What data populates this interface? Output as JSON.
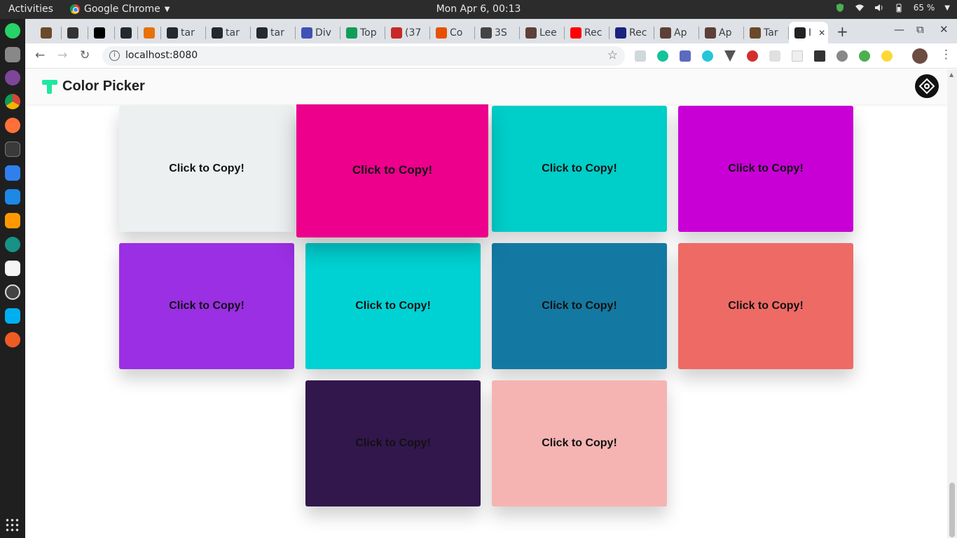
{
  "system": {
    "activities": "Activities",
    "app_name": "Google Chrome",
    "clock": "Mon Apr  6, 00:13",
    "battery": "65 %"
  },
  "browser": {
    "tabs": [
      {
        "label": "",
        "color": "#6b4a2b"
      },
      {
        "label": "",
        "color": "#333333"
      },
      {
        "label": "",
        "color": "#000000"
      },
      {
        "label": "",
        "color": "#24292e"
      },
      {
        "label": "",
        "color": "#e8710a"
      },
      {
        "label": "tar",
        "color": "#24292e"
      },
      {
        "label": "tar",
        "color": "#24292e"
      },
      {
        "label": "tar",
        "color": "#24292e"
      },
      {
        "label": "Div",
        "color": "#3f51b5"
      },
      {
        "label": "Top",
        "color": "#0f9d58"
      },
      {
        "label": "(37",
        "color": "#c62828"
      },
      {
        "label": "Co",
        "color": "#e65100"
      },
      {
        "label": "3S",
        "color": "#444444"
      },
      {
        "label": "Lee",
        "color": "#5d4037"
      },
      {
        "label": "Rec",
        "color": "#ff0000"
      },
      {
        "label": "Rec",
        "color": "#1a237e"
      },
      {
        "label": "Ap",
        "color": "#5d4037"
      },
      {
        "label": "Ap",
        "color": "#5d4037"
      },
      {
        "label": "Tar",
        "color": "#6b4a2b"
      },
      {
        "label": "I",
        "color": "#222222",
        "active": true
      }
    ],
    "url": "localhost:8080"
  },
  "app": {
    "title": "Color Picker",
    "cards": [
      {
        "label": "Click to Copy!",
        "color": "#ecf0f1"
      },
      {
        "label": "Click to Copy!",
        "color": "#ec008c"
      },
      {
        "label": "Click to Copy!",
        "color": "#00cec9"
      },
      {
        "label": "Click to Copy!",
        "color": "#c800d6"
      },
      {
        "label": "Click to Copy!",
        "color": "#9b2fe3"
      },
      {
        "label": "Click to Copy!",
        "color": "#00d2d3"
      },
      {
        "label": "Click to Copy!",
        "color": "#1479a2"
      },
      {
        "label": "Click to Copy!",
        "color": "#ee6a65"
      },
      {
        "label": "Click to Copy!",
        "color": "#32174d"
      },
      {
        "label": "Click to Copy!",
        "color": "#f5b4b2"
      }
    ]
  }
}
